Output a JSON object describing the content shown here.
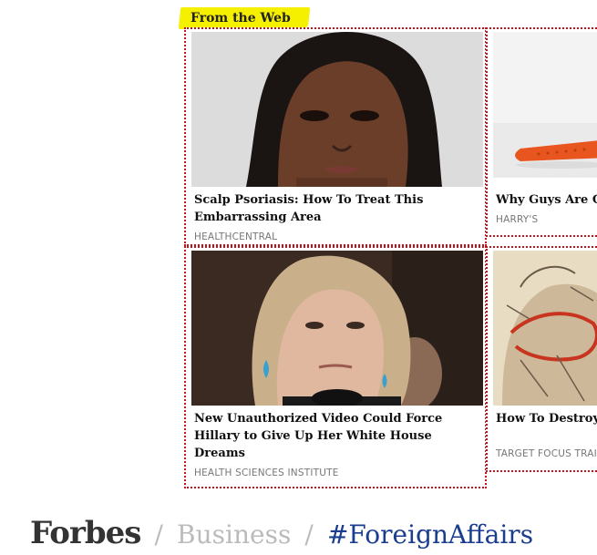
{
  "section": {
    "header": "From the Web"
  },
  "cards": [
    {
      "title": "Scalp Psoriasis: How To Treat This Embarrassing Area",
      "source": "HEALTHCENTRAL",
      "image": "woman-portrait"
    },
    {
      "title": "Why Guys Are C",
      "source": "HARRY'S",
      "image": "orange-razor"
    },
    {
      "title": "New Unauthorized Video Could Force Hillary to Give Up Her White House Dreams",
      "source": "HEALTH SCIENCES INSTITUTE",
      "image": "politician-portrait"
    },
    {
      "title": "How To Destroy Using Only You",
      "source": "TARGET FOCUS TRAIN",
      "image": "vintage-illustration"
    }
  ],
  "footer": {
    "brand": "Forbes",
    "separator": "/",
    "section": "Business",
    "topic": "#ForeignAffairs"
  },
  "colors": {
    "highlight": "#f4f000",
    "border": "#c0141c",
    "topic": "#1a3d8f"
  }
}
